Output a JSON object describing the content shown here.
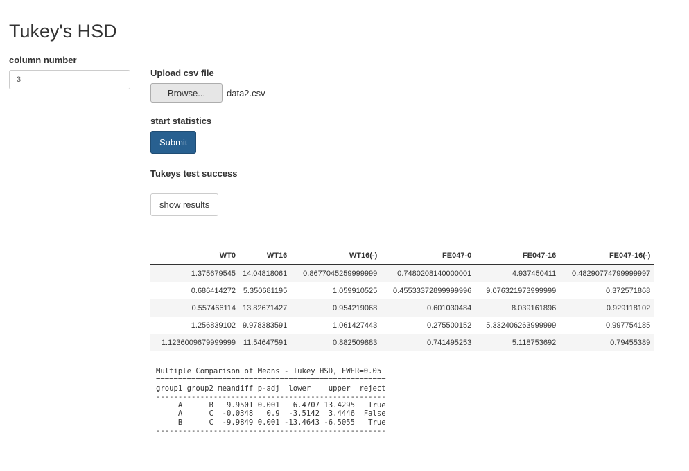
{
  "app": {
    "title": "Tukey's HSD"
  },
  "sidebar": {
    "column_label": "column number",
    "column_value": "3"
  },
  "upload": {
    "label": "Upload csv file",
    "browse_label": "Browse...",
    "file_name": "data2.csv"
  },
  "stats": {
    "label": "start statistics",
    "submit_label": "Submit",
    "success_text": "Tukeys test success",
    "show_results_label": "show results"
  },
  "table": {
    "headers": [
      "WT0",
      "WT16",
      "WT16(-)",
      "FE047-0",
      "FE047-16",
      "FE047-16(-)"
    ],
    "rows": [
      [
        "1.375679545",
        "14.04818061",
        "0.8677045259999999",
        "0.7480208140000001",
        "4.937450411",
        "0.48290774799999997"
      ],
      [
        "0.686414272",
        "5.350681195",
        "1.059910525",
        "0.45533372899999996",
        "9.076321973999999",
        "0.372571868"
      ],
      [
        "0.557466114",
        "13.82671427",
        "0.954219068",
        "0.601030484",
        "8.039161896",
        "0.929118102"
      ],
      [
        "1.256839102",
        "9.978383591",
        "1.061427443",
        "0.275500152",
        "5.332406263999999",
        "0.997754185"
      ],
      [
        "1.1236009679999999",
        "11.54647591",
        "0.882509883",
        "0.741495253",
        "5.118753692",
        "0.79455389"
      ]
    ]
  },
  "summary": {
    "lines": [
      "Multiple Comparison of Means - Tukey HSD, FWER=0.05",
      "====================================================",
      "group1 group2 meandiff p-adj  lower    upper  reject",
      "----------------------------------------------------",
      "     A      B   9.9501 0.001   6.4707 13.4295   True",
      "     A      C  -0.0348   0.9  -3.5142  3.4446  False",
      "     B      C  -9.9849 0.001 -13.4643 -6.5055   True",
      "----------------------------------------------------"
    ]
  }
}
